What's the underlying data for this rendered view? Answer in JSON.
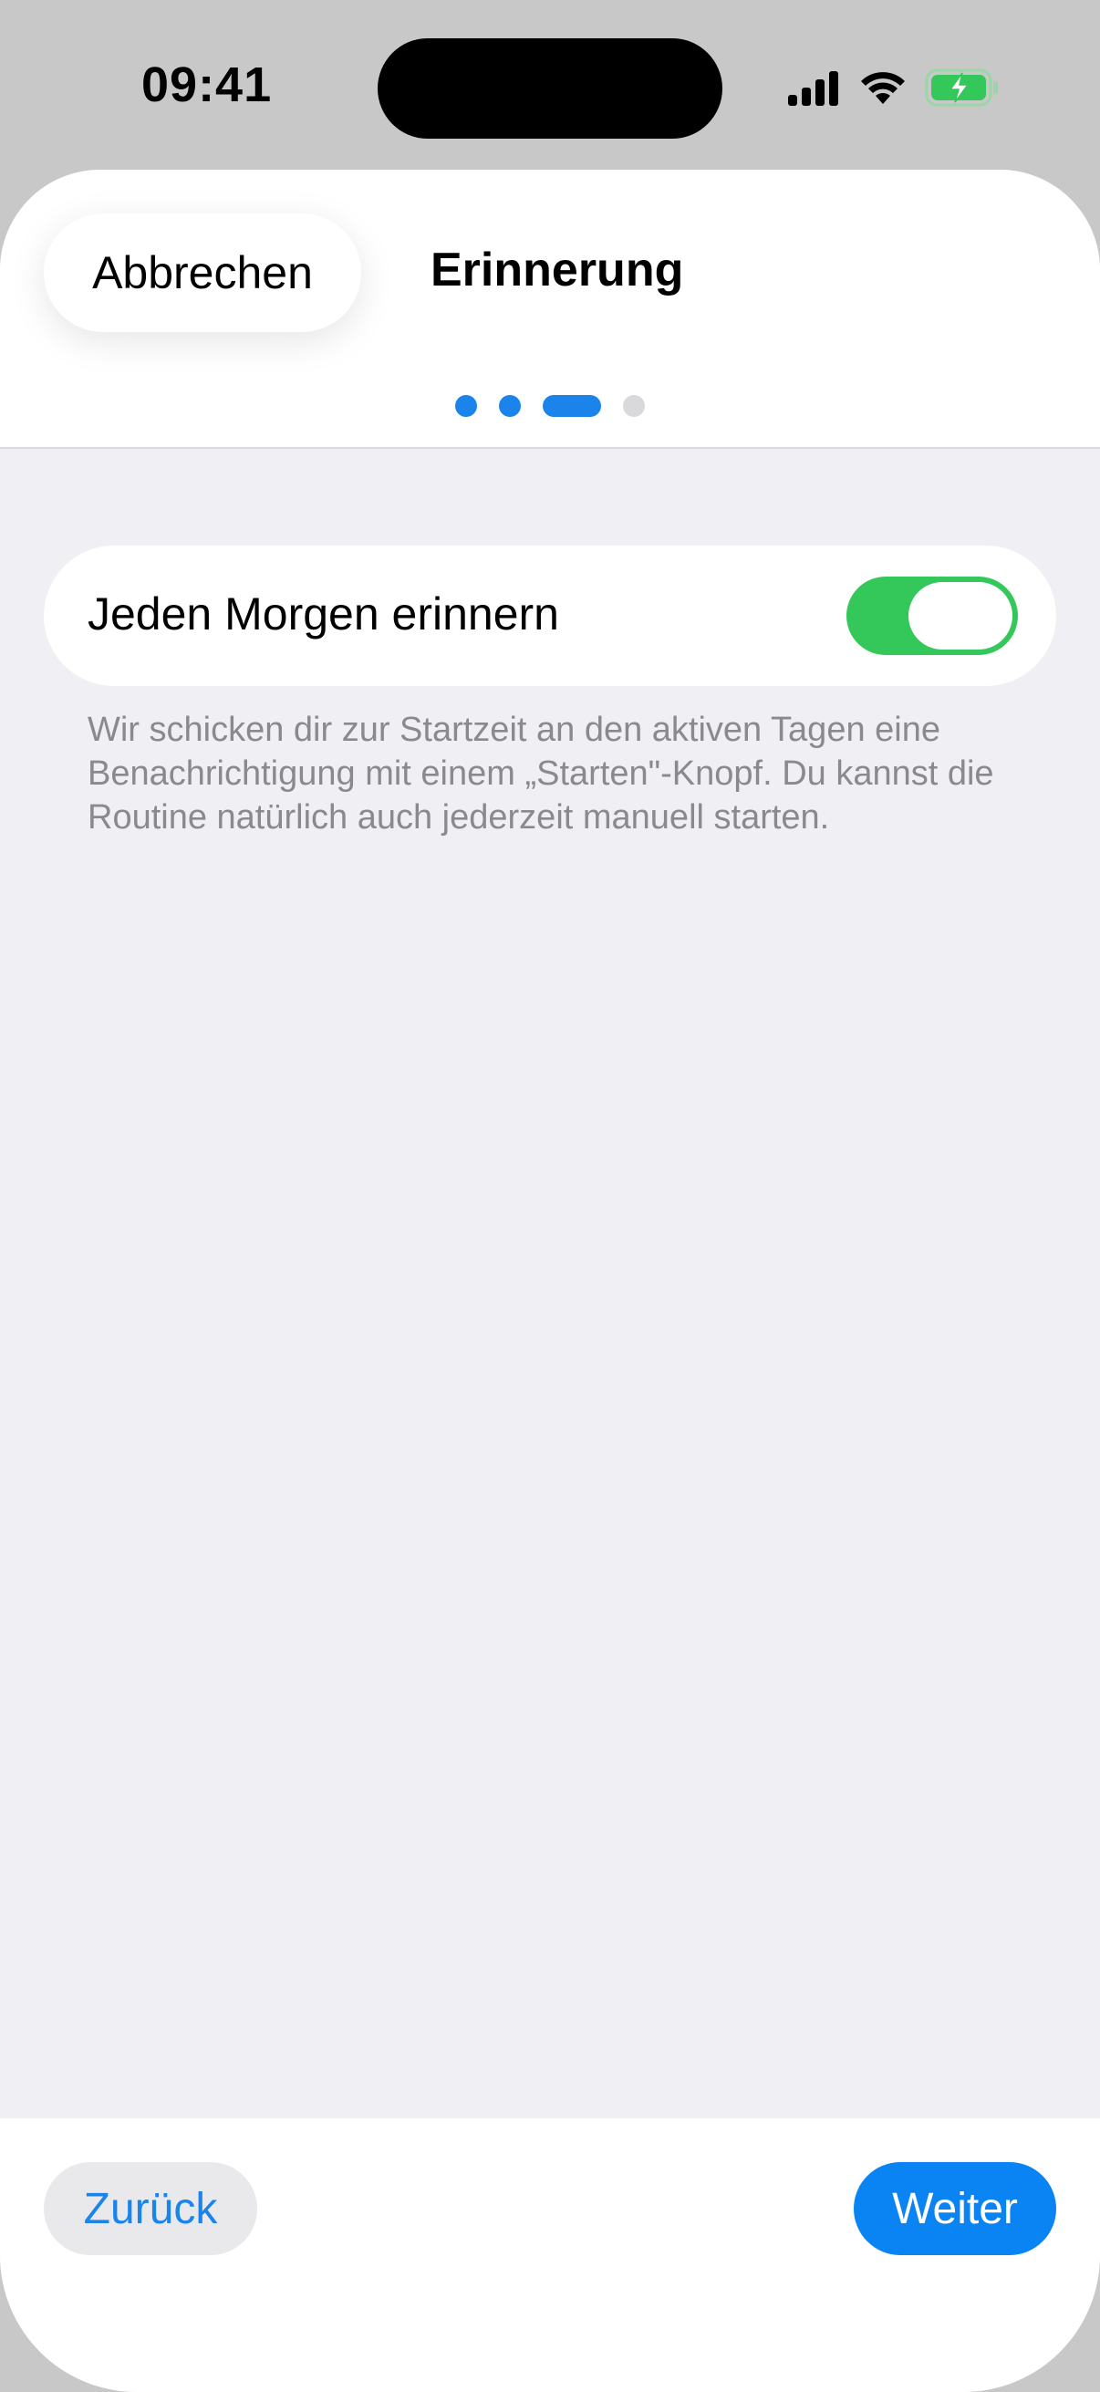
{
  "status_bar": {
    "time": "09:41",
    "icons": [
      "cellular-signal-icon",
      "wifi-icon",
      "battery-charging-icon"
    ],
    "battery_color": "#34c759"
  },
  "header": {
    "cancel_label": "Abbrechen",
    "title": "Erinnerung",
    "steps": {
      "total": 4,
      "current": 3
    }
  },
  "reminder": {
    "label": "Jeden Morgen erinnern",
    "enabled": true,
    "footnote": "Wir schicken dir zur Startzeit an den aktiven Tagen eine Benachrichtigung mit einem „Starten\"-Knopf. Du kannst die Routine natürlich auch jederzeit manuell starten."
  },
  "footer": {
    "back_label": "Zurück",
    "next_label": "Weiter"
  },
  "colors": {
    "accent": "#0a84f2",
    "toggle_on": "#34c759",
    "background": "#f0f0f4"
  }
}
